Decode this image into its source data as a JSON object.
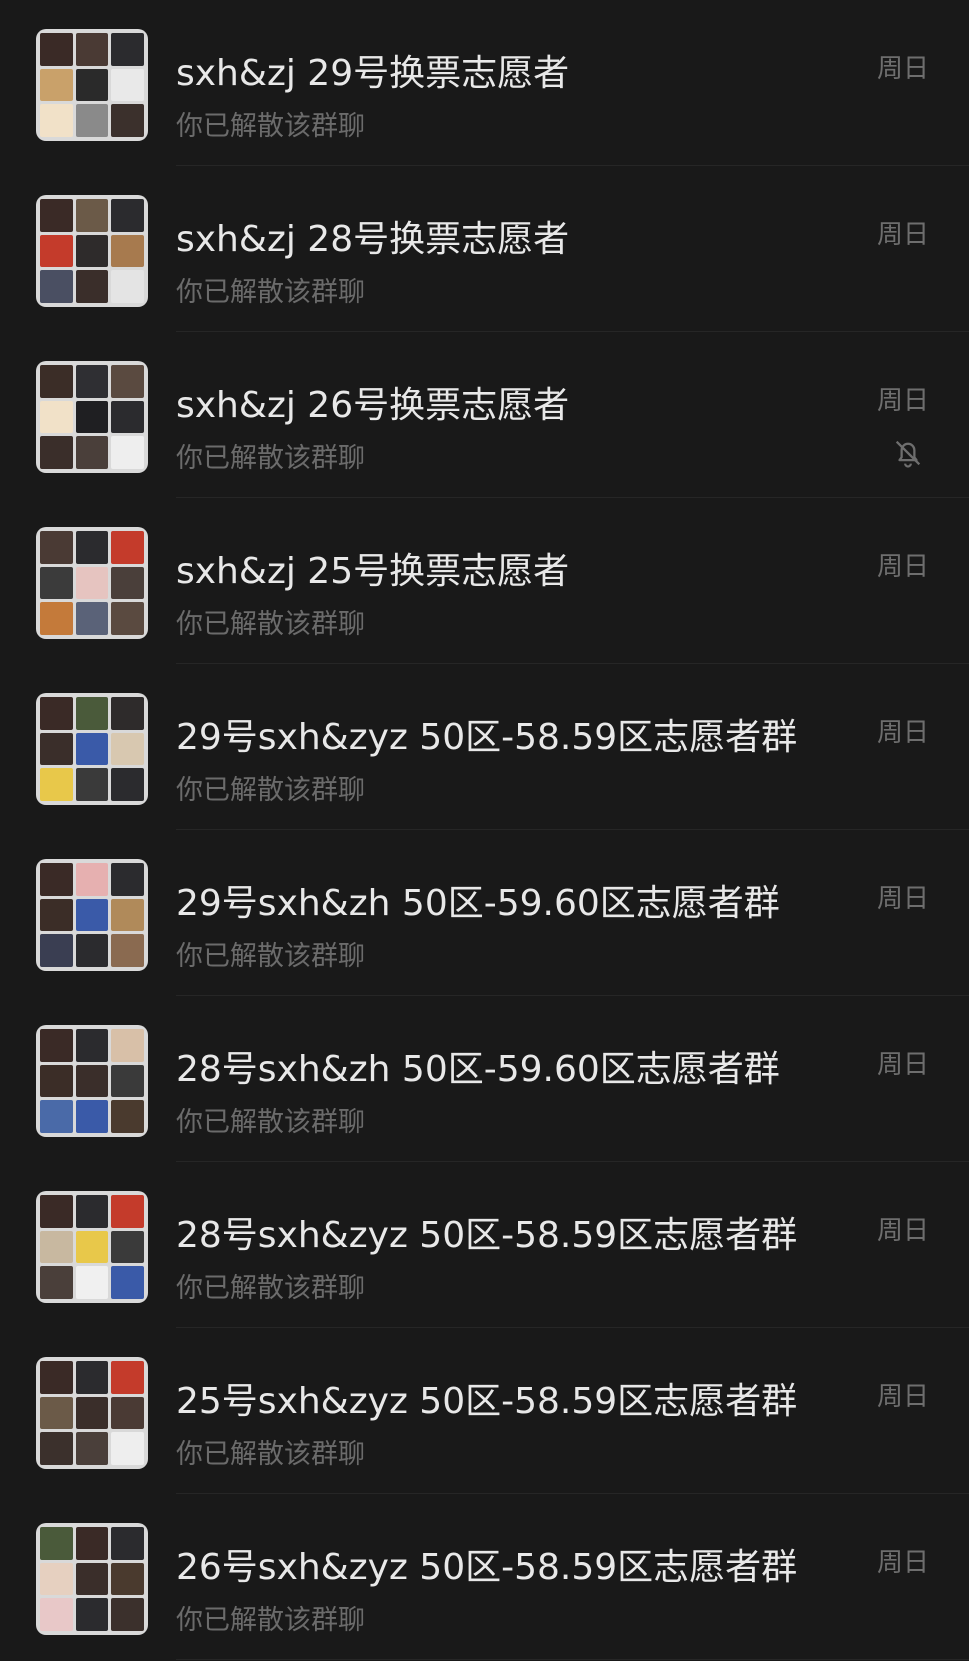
{
  "chats": [
    {
      "title": "sxh&zj 29号换票志愿者",
      "subtitle": "你已解散该群聊",
      "time": "周日",
      "muted": false
    },
    {
      "title": "sxh&zj 28号换票志愿者",
      "subtitle": "你已解散该群聊",
      "time": "周日",
      "muted": false
    },
    {
      "title": "sxh&zj 26号换票志愿者",
      "subtitle": "你已解散该群聊",
      "time": "周日",
      "muted": true
    },
    {
      "title": "sxh&zj 25号换票志愿者",
      "subtitle": "你已解散该群聊",
      "time": "周日",
      "muted": false
    },
    {
      "title": "29号sxh&zyz 50区-58.59区志愿者群",
      "subtitle": "你已解散该群聊",
      "time": "周日",
      "muted": false
    },
    {
      "title": "29号sxh&zh 50区-59.60区志愿者群",
      "subtitle": "你已解散该群聊",
      "time": "周日",
      "muted": false
    },
    {
      "title": "28号sxh&zh 50区-59.60区志愿者群",
      "subtitle": "你已解散该群聊",
      "time": "周日",
      "muted": false
    },
    {
      "title": "28号sxh&zyz 50区-58.59区志愿者群",
      "subtitle": "你已解散该群聊",
      "time": "周日",
      "muted": false
    },
    {
      "title": "25号sxh&zyz 50区-58.59区志愿者群",
      "subtitle": "你已解散该群聊",
      "time": "周日",
      "muted": false
    },
    {
      "title": "26号sxh&zyz 50区-58.59区志愿者群",
      "subtitle": "你已解散该群聊",
      "time": "周日",
      "muted": false
    }
  ],
  "colors": {
    "background": "#191919",
    "title": "#e8e8e8",
    "subtitle": "#6b6b6b",
    "time": "#6e6e6e",
    "divider": "#262626",
    "avatar_bg": "#d9d9d9"
  },
  "icons": {
    "avatar": "group-avatar-grid-icon",
    "mute": "bell-off-icon"
  }
}
